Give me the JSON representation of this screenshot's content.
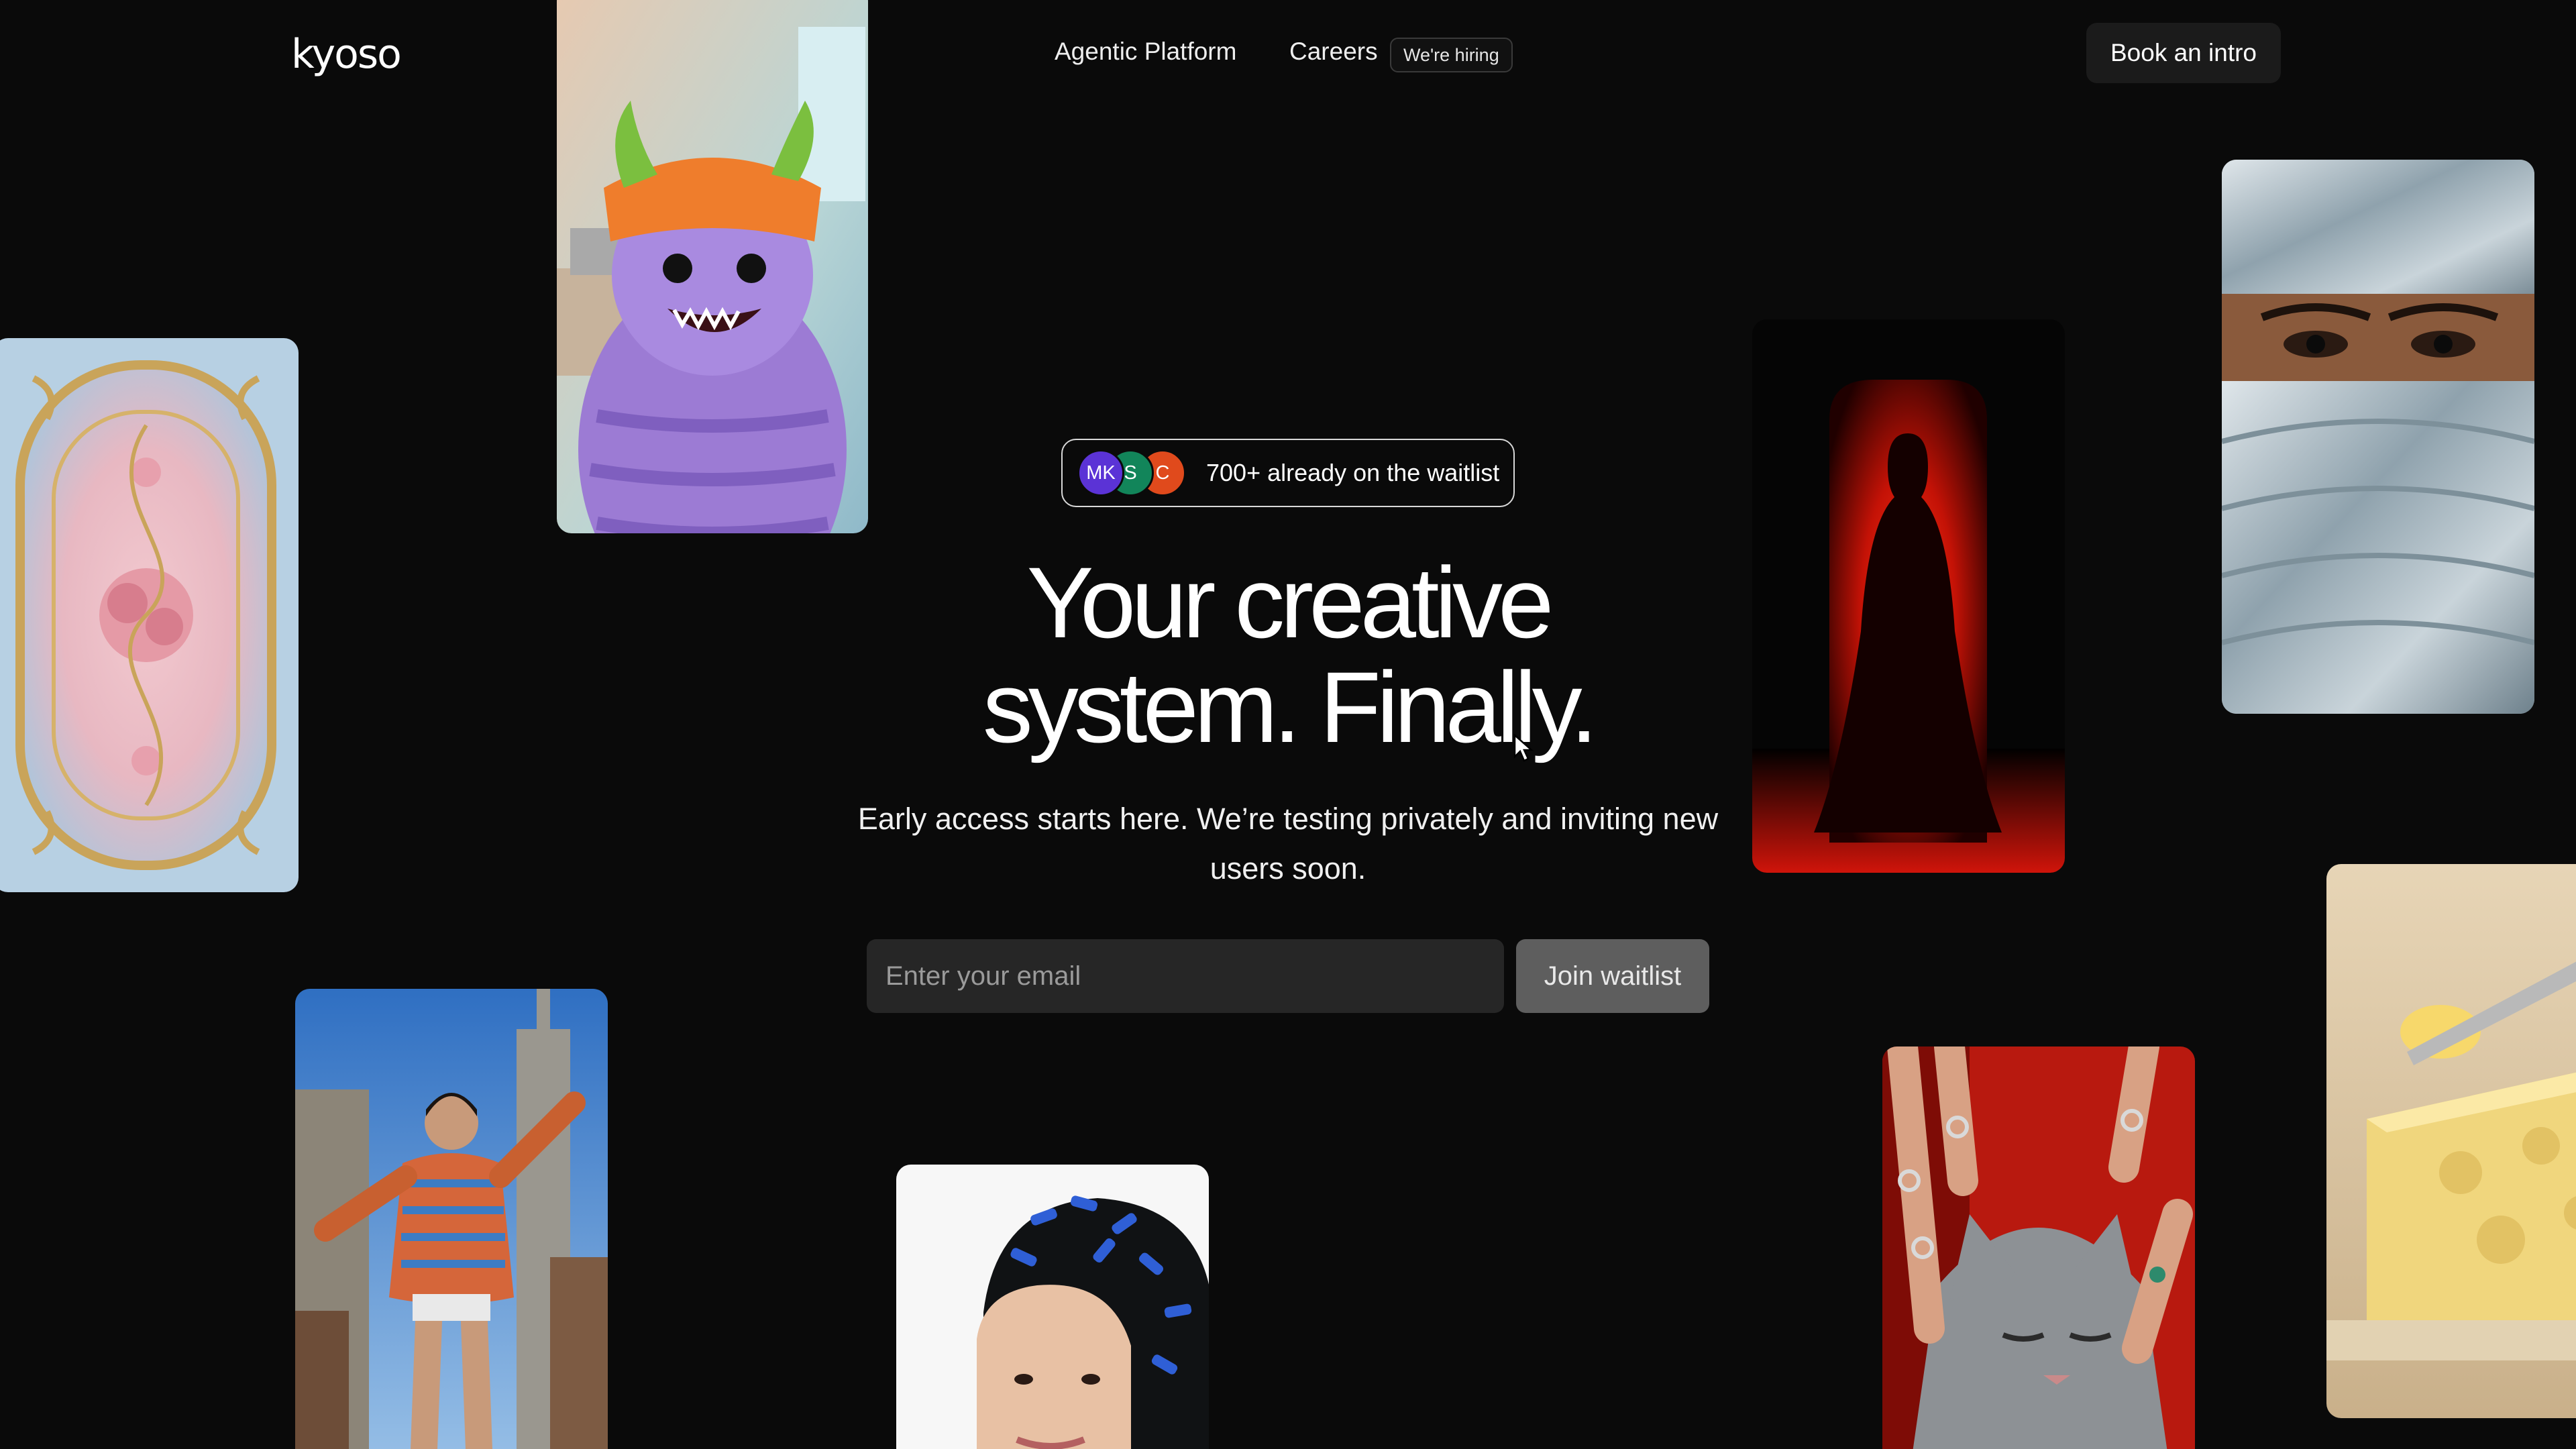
{
  "brand": {
    "logo_text": "kyoso"
  },
  "nav": {
    "links": [
      {
        "label": "Agentic Platform"
      },
      {
        "label": "Careers"
      }
    ],
    "hiring_badge": "We're hiring",
    "cta_label": "Book an intro"
  },
  "hero": {
    "waitlist_pill": {
      "avatars": [
        {
          "initials": "MK",
          "color": "#5b33d6"
        },
        {
          "initials": "S",
          "color": "#12855a"
        },
        {
          "initials": "C",
          "color": "#e04a1c"
        }
      ],
      "text": "700+ already on the waitlist"
    },
    "headline_line1": "Your creative",
    "headline_line2": "system. Finally.",
    "subtext": "Early access starts here. We’re testing privately and inviting new users soon.",
    "email_placeholder": "Enter your email",
    "email_value": "",
    "join_label": "Join waitlist"
  },
  "gallery": [
    {
      "name": "ornament-image",
      "subject": "pink and blue rococo ornamental panel"
    },
    {
      "name": "monster-image",
      "subject": "purple furry monster in orange beanie"
    },
    {
      "name": "silhouette-image",
      "subject": "silhouette figure in red glowing doorway"
    },
    {
      "name": "masked-face-image",
      "subject": "man with silver metallic face wrap"
    },
    {
      "name": "city-dancer-image",
      "subject": "woman in striped sweater among skyscrapers"
    },
    {
      "name": "hair-clips-image",
      "subject": "woman with blue hair clips"
    },
    {
      "name": "cat-rings-image",
      "subject": "grey cat with ringed hands"
    },
    {
      "name": "cheese-image",
      "subject": "cheese block with butter knife"
    }
  ],
  "theme": {
    "background": "#0a0a0a",
    "text": "#ffffff",
    "input_bg": "#262626",
    "button_bg": "#5e5e5e"
  }
}
